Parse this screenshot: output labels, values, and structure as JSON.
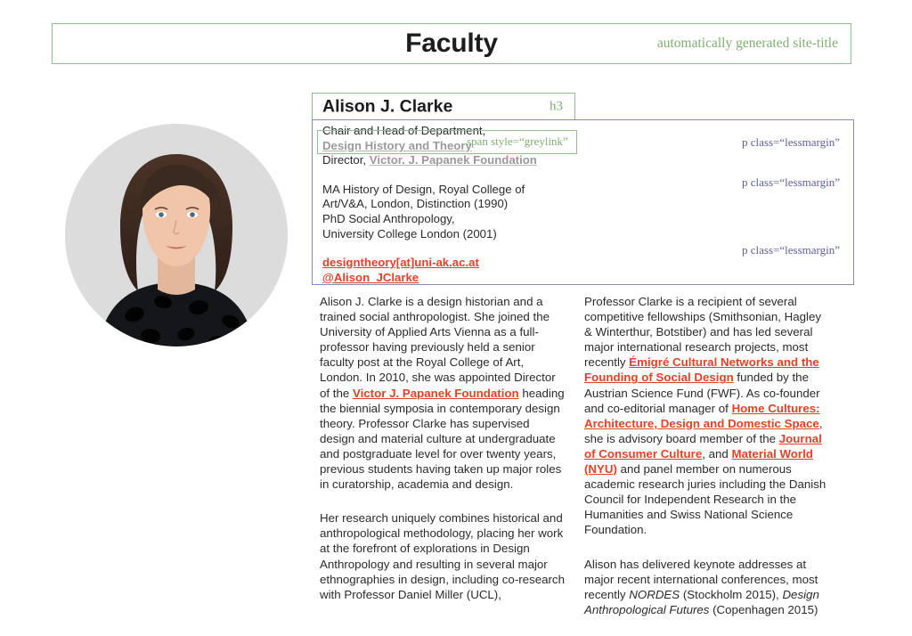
{
  "header": {
    "title": "Faculty",
    "annotation": "automatically generated site-title"
  },
  "portrait": {
    "alt": "portrait-photo-alison-clarke"
  },
  "profile": {
    "name": "Alison J. Clarke",
    "heading_tag": "h3",
    "role_block": {
      "line1": "Chair and Head of Department,",
      "greylink1": "Design History and Theory",
      "line2_prefix": "Director, ",
      "greylink2": "Victor. J. Papanek Foundation",
      "annotation": "span style=“greylink”"
    },
    "education": [
      "MA History of Design, Royal College of",
      "Art/V&A, London, Distinction (1990)",
      "PhD Social Anthropology,",
      "University College London (2001)"
    ],
    "contact": {
      "email": "designtheory[at]uni-ak.ac.at",
      "twitter": "@Alison_JClarke"
    },
    "paragraph_annotations": [
      "p class=“lessmargin”",
      "p class=“lessmargin”",
      "p class=“lessmargin”"
    ]
  },
  "body": {
    "left_column": {
      "para1": {
        "before_link": "Alison J. Clarke is a design historian and a trained social anthropologist. She joined the University of Applied Arts Vienna as a full-professor having previously held a senior faculty post at the Royal College of Art, London. In 2010, she was appointed Director of the ",
        "link": "Victor J. Papanek Foundation",
        "after_link": " heading the biennial symposia in contemporary design theory. Professor Clarke has supervised design and material culture at undergraduate and postgraduate level for over twenty years, previous students having taken up major roles in curatorship, academia and design."
      },
      "para2": "Her research uniquely combines historical and anthropological methodology, placing her work at the forefront of explorations in Design Anthropology and resulting in several major ethnographies in design, including co-research with Professor Daniel Miller (UCL),"
    },
    "right_column": {
      "para1": {
        "seg1": "Professor Clarke is a recipient of several competitive fellowships (Smithsonian, Hagley & Winterthur, Botstiber) and has led several major international research projects, most recently ",
        "link1": "Émigré Cultural Networks and the Founding of Social Design",
        "seg2": " funded by the Austrian Science Fund (FWF). As co-founder and co-editorial manager of ",
        "link2": "Home Cultures: Architecture, Design and Domestic Space",
        "seg3": ", she is advisory board member of the ",
        "link3": "Journal of Consumer Culture",
        "seg4": ", and ",
        "link4": "Material World (NYU)",
        "seg5": " and panel member on numerous academic research juries including the Danish Council for Independent Research in the Humanities and Swiss National Science Foundation."
      },
      "para2": {
        "seg1": "Alison has delivered keynote addresses at major recent international conferences, most recently ",
        "italic1": "NORDES",
        "seg2": " (Stockholm 2015), ",
        "italic2": "Design Anthropological Futures",
        "seg3": " (Copenhagen 2015)"
      }
    }
  },
  "colors": {
    "green_annotation": "#7fae72",
    "purple_annotation": "#5f5f9b",
    "red_link": "#e24228",
    "grey_link": "#9a9a9a"
  }
}
